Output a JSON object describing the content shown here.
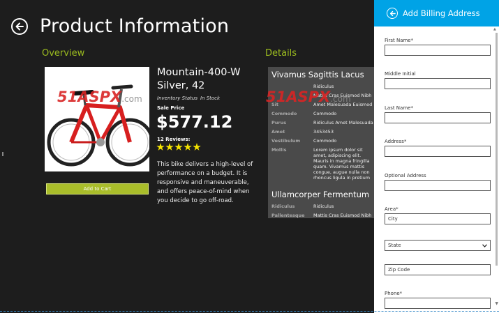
{
  "header": {
    "title": "Product Information"
  },
  "overview": {
    "heading": "Overview",
    "product_name": "Mountain-400-W Silver, 42",
    "inventory_label": "Inventory Status",
    "inventory_value": "In Stock",
    "sale_label": "Sale Price",
    "price": "$577.12",
    "reviews": "12 Reviews:",
    "rating": 5,
    "description": "This bike delivers a high-level of performance on a budget. It is responsive and maneuverable, and offers peace-of-mind when you decide to go off-road.",
    "add_to_cart": "Add to Cart"
  },
  "watermark": {
    "brand": "51ASPX",
    "domain": ".com"
  },
  "details": {
    "heading": "Details",
    "group1_title": "Vivamus Sagittis Lacus",
    "group1_rows": [
      {
        "k": "",
        "v": "Ridiculus"
      },
      {
        "k": "",
        "v": "Mattis Cras Euismod Nibh"
      },
      {
        "k": "Sit",
        "v": "Amet Malesuada Euismod Elit"
      },
      {
        "k": "Commodo",
        "v": "Commodo"
      },
      {
        "k": "Purus",
        "v": "Ridiculus Amet Malesuada Elit"
      },
      {
        "k": "Amet",
        "v": "3453453"
      },
      {
        "k": "Vestibulum",
        "v": "Commodo"
      },
      {
        "k": "Mollis",
        "v": "Lorem ipsum dolor sit amet, adipiscing elit. Mauris in magna fringilla quam. Vivamus mattis congue, augue nulla non rhoncus ligula in pretium"
      }
    ],
    "group2_title": "Ullamcorper Fermentum",
    "group2_rows": [
      {
        "k": "Ridiculus",
        "v": "Ridiculus"
      },
      {
        "k": "Pallentesque",
        "v": "Mattis Cras Euismod Nibh"
      }
    ]
  },
  "billing": {
    "title": "Add Billing Address",
    "first_name": "First Name*",
    "middle_initial": "Middle Initial",
    "last_name": "Last Name*",
    "address": "Address*",
    "optional_address": "Optional Address",
    "area": "Area*",
    "city_value": "City",
    "state_value": "State",
    "zip_value": "Zip Code",
    "phone": "Phone*"
  },
  "colors": {
    "accent_green": "#9bbb1f",
    "header_blue": "#00a3e6",
    "button_green": "#a9bd2a",
    "star_yellow": "#f5e400"
  }
}
